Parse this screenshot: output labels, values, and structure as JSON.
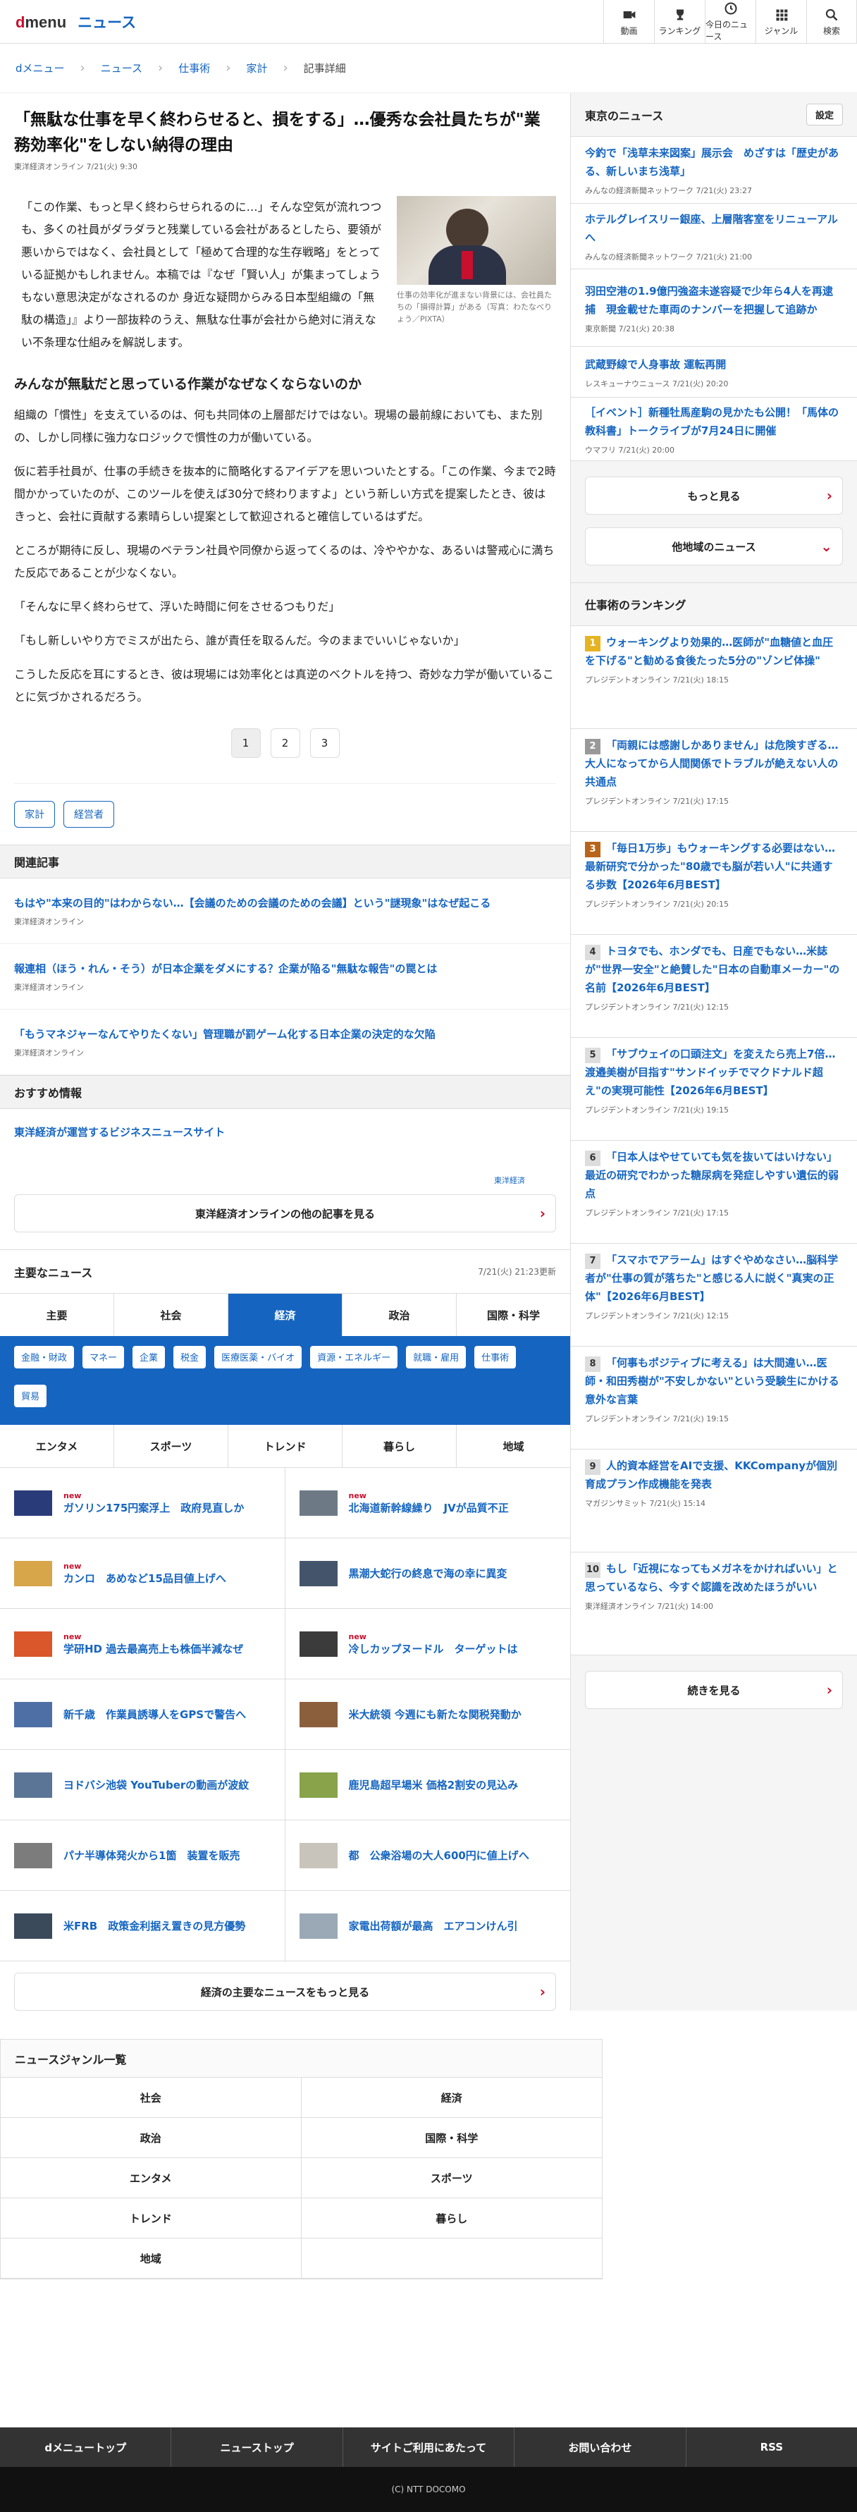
{
  "header": {
    "logo_d": "d",
    "logo_menu": "menu",
    "service": "ニュース",
    "nav": [
      "動画",
      "ランキング",
      "今日のニュース",
      "ジャンル",
      "検索"
    ]
  },
  "breadcrumb": [
    "dメニュー",
    "ニュース",
    "仕事術",
    "家計",
    "記事詳細"
  ],
  "article": {
    "title": "「無駄な仕事を早く終わらせると、損をする」…優秀な会社員たちが\"業務効率化\"をしない納得の理由",
    "meta": "東洋経済オンライン 7/21(火) 9:30",
    "lead": "「この作業、もっと早く終わらせられるのに…」そんな空気が流れつつも、多くの社員がダラダラと残業している会社があるとしたら、要領が悪いからではなく、会社員として「極めて合理的な生存戦略」をとっている証拠かもしれません。本稿では『なぜ「賢い人」が集まってしょうもない意思決定がなされるのか 身近な疑問からみる日本型組織の「無駄の構造」』より一部抜粋のうえ、無駄な仕事が会社から絶対に消えない不条理な仕組みを解説します。",
    "photo_caption": "仕事の効率化が進まない背景には、会社員たちの「損得計算」がある（写真：わたなべりょう／PIXTA）",
    "subheading": "みんなが無駄だと思っている作業がなぜなくならないのか",
    "paragraphs": [
      "組織の「慣性」を支えているのは、何も共同体の上層部だけではない。現場の最前線においても、また別の、しかし同様に強力なロジックで慣性の力が働いている。",
      "仮に若手社員が、仕事の手続きを抜本的に簡略化するアイデアを思いついたとする。「この作業、今まで2時間かかっていたのが、このツールを使えば30分で終わりますよ」という新しい方式を提案したとき、彼はきっと、会社に貢献する素晴らしい提案として歓迎されると確信しているはずだ。",
      "ところが期待に反し、現場のベテラン社員や同僚から返ってくるのは、冷ややかな、あるいは警戒心に満ちた反応であることが少なくない。",
      "「そんなに早く終わらせて、浮いた時間に何をさせるつもりだ」",
      "「もし新しいやり方でミスが出たら、誰が責任を取るんだ。今のままでいいじゃないか」",
      "こうした反応を耳にするとき、彼は現場には効率化とは真逆のベクトルを持つ、奇妙な力学が働いていることに気づかされるだろう。"
    ],
    "pages": [
      "1",
      "2",
      "3"
    ],
    "tags": [
      "家計",
      "経営者"
    ]
  },
  "related": {
    "heading": "関連記事",
    "items": [
      {
        "title": "もはや\"本来の目的\"はわからない…【会議のための会議のための会議】という\"謎現象\"はなぜ起こる",
        "source": "東洋経済オンライン"
      },
      {
        "title": "報連相（ほう・れん・そう）が日本企業をダメにする？企業が陥る\"無駄な報告\"の罠とは",
        "source": "東洋経済オンライン"
      },
      {
        "title": "「もうマネジャーなんてやりたくない」管理職が罰ゲーム化する日本企業の決定的な欠陥",
        "source": "東洋経済オンライン"
      }
    ]
  },
  "recommend": {
    "heading": "おすすめ情報",
    "link": "東洋経済が運営するビジネスニュースサイト",
    "logo": "東洋経済",
    "more": "東洋経済オンラインの他の記事を見る"
  },
  "major": {
    "heading": "主要なニュース",
    "updated": "7/21(火) 21:23更新",
    "tabs1": [
      "主要",
      "社会",
      "経済",
      "政治",
      "国際・科学"
    ],
    "subtags": [
      "金融・財政",
      "マネー",
      "企業",
      "税金",
      "医療医薬・バイオ",
      "資源・エネルギー",
      "就職・雇用",
      "仕事術",
      "貿易"
    ],
    "tabs2": [
      "エンタメ",
      "スポーツ",
      "トレンド",
      "暮らし",
      "地域"
    ],
    "new_label": "new",
    "items": [
      {
        "title": "ガソリン175円案浮上　政府見直しか",
        "new": true,
        "c": "#2a3b7a"
      },
      {
        "title": "北海道新幹線繰り　JVが品質不正",
        "new": true,
        "c": "#6d7a86"
      },
      {
        "title": "カンロ　あめなど15品目値上げへ",
        "new": true,
        "c": "#d7a64a"
      },
      {
        "title": "黒潮大蛇行の終息で海の幸に異変",
        "new": false,
        "c": "#44556b"
      },
      {
        "title": "学研HD 過去最高売上も株価半減なぜ",
        "new": true,
        "c": "#d9572b"
      },
      {
        "title": "冷しカップヌードル　ターゲットは",
        "new": true,
        "c": "#3b3b3b"
      },
      {
        "title": "新千歳　作業員誘導人をGPSで警告へ",
        "new": false,
        "c": "#4d6fa5"
      },
      {
        "title": "米大統領 今週にも新たな関税発動か",
        "new": false,
        "c": "#8b5e3c"
      },
      {
        "title": "ヨドバシ池袋 YouTuberの動画が波紋",
        "new": false,
        "c": "#5a7595"
      },
      {
        "title": "鹿児島超早場米 価格2割安の見込み",
        "new": false,
        "c": "#88a34a"
      },
      {
        "title": "パナ半導体発火から1箇　装置を販売",
        "new": false,
        "c": "#7c7c7c"
      },
      {
        "title": "都　公衆浴場の大人600円に値上げへ",
        "new": false,
        "c": "#c9c4bb"
      },
      {
        "title": "米FRB　政策金利据え置きの見方優勢",
        "new": false,
        "c": "#3a4a5a"
      },
      {
        "title": "家電出荷額が最高　エアコンけん引",
        "new": false,
        "c": "#9aa9b5"
      }
    ],
    "more": "経済の主要なニュースをもっと見る"
  },
  "genre": {
    "heading": "ニュースジャンル一覧",
    "items": [
      "社会",
      "経済",
      "政治",
      "国際・科学",
      "エンタメ",
      "スポーツ",
      "トレンド",
      "暮らし",
      "地域"
    ]
  },
  "footer": {
    "nav": [
      "dメニュートップ",
      "ニューストップ",
      "サイトご利用にあたって",
      "お問い合わせ",
      "RSS"
    ],
    "copyright": "(C) NTT DOCOMO"
  },
  "side": {
    "tokyo_heading": "東京のニュース",
    "settings": "設定",
    "tokyo": [
      {
        "title": "今釣で「浅草未来図案」展示会　めざすは「歴史がある、新しいまち浅草」",
        "source": "みんなの経済新聞ネットワーク 7/21(火) 23:27"
      },
      {
        "title": "ホテルグレイスリー銀座、上層階客室をリニューアルへ",
        "source": "みんなの経済新聞ネットワーク 7/21(火) 21:00"
      },
      {
        "title": "羽田空港の1.9億円強盗未遂容疑で少年ら4人を再逮捕　現金載せた車両のナンバーを把握して追跡か",
        "source": "東京新聞 7/21(火) 20:38"
      },
      {
        "title": "武蔵野線で人身事故 運転再開",
        "source": "レスキューナウニュース 7/21(火) 20:20"
      },
      {
        "title": "［イベント］新種牡馬産駒の見かたも公開！「馬体の教科書」トークライブが7月24日に開催",
        "source": "ウマフリ 7/21(火) 20:00"
      }
    ],
    "more": "もっと見る",
    "other": "他地域のニュース",
    "ranking_heading": "仕事術のランキング",
    "ranking": [
      {
        "n": "1",
        "title": "ウォーキングより効果的…医師が\"血糖値と血圧を下げる\"と勧める食後たった5分の\"ゾンビ体操\"",
        "source": "プレジデントオンライン 7/21(火) 18:15"
      },
      {
        "n": "2",
        "title": "「両親には感謝しかありません」は危険すぎる…大人になってから人間関係でトラブルが絶えない人の共通点",
        "source": "プレジデントオンライン 7/21(火) 17:15"
      },
      {
        "n": "3",
        "title": "「毎日1万歩」もウォーキングする必要はない…最新研究で分かった\"80歳でも脳が若い人\"に共通する歩数【2026年6月BEST】",
        "source": "プレジデントオンライン 7/21(火) 20:15"
      },
      {
        "n": "4",
        "title": "トヨタでも、ホンダでも、日産でもない…米誌が\"世界一安全\"と絶賛した\"日本の自動車メーカー\"の名前【2026年6月BEST】",
        "source": "プレジデントオンライン 7/21(火) 12:15"
      },
      {
        "n": "5",
        "title": "「サブウェイの口頭注文」を変えたら売上7倍…渡邉美樹が目指す\"サンドイッチでマクドナルド超え\"の実現可能性【2026年6月BEST】",
        "source": "プレジデントオンライン 7/21(火) 19:15"
      },
      {
        "n": "6",
        "title": "「日本人はやせていても気を抜いてはいけない」最近の研究でわかった糖尿病を発症しやすい遺伝的弱点",
        "source": "プレジデントオンライン 7/21(火) 17:15"
      },
      {
        "n": "7",
        "title": "「スマホでアラーム」はすぐやめなさい…脳科学者が\"仕事の質が落ちた\"と感じる人に説く\"真実の正体\"【2026年6月BEST】",
        "source": "プレジデントオンライン 7/21(火) 12:15"
      },
      {
        "n": "8",
        "title": "「何事もポジティブに考える」は大間違い…医師・和田秀樹が\"不安しかない\"という受験生にかける意外な言葉",
        "source": "プレジデントオンライン 7/21(火) 19:15"
      },
      {
        "n": "9",
        "title": "人的資本経営をAIで支援、KKCompanyが個別育成プラン作成機能を発表",
        "source": "マガジンサミット 7/21(火) 15:14"
      },
      {
        "n": "10",
        "title": "もし「近視になってもメガネをかければいい」と思っているなら、今すぐ認識を改めたほうがいい",
        "source": "東洋経済オンライン 7/21(火) 14:00"
      }
    ],
    "ranking_more": "続きを見る"
  }
}
